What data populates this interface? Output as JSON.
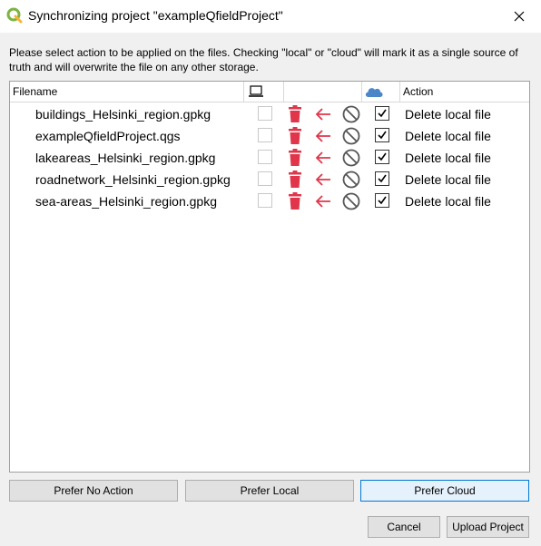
{
  "window": {
    "title": "Synchronizing project \"exampleQfieldProject\"",
    "app_icon": "qgis-q-icon",
    "close_icon": "close-x-icon"
  },
  "description": "Please select action to be applied on the files. Checking \"local\" or \"cloud\" will mark it as a single source of truth and will overwrite the file on any other storage.",
  "table": {
    "headers": {
      "filename": "Filename",
      "local_icon": "laptop-icon",
      "cloud_icon": "cloud-icon",
      "action": "Action"
    },
    "rows": [
      {
        "filename": "buildings_Helsinki_region.gpkg",
        "local_checked": false,
        "cloud_checked": true,
        "action": "Delete local file"
      },
      {
        "filename": "exampleQfieldProject.qgs",
        "local_checked": false,
        "cloud_checked": true,
        "action": "Delete local file"
      },
      {
        "filename": "lakeareas_Helsinki_region.gpkg",
        "local_checked": false,
        "cloud_checked": true,
        "action": "Delete local file"
      },
      {
        "filename": "roadnetwork_Helsinki_region.gpkg",
        "local_checked": false,
        "cloud_checked": true,
        "action": "Delete local file"
      },
      {
        "filename": "sea-areas_Helsinki_region.gpkg",
        "local_checked": false,
        "cloud_checked": true,
        "action": "Delete local file"
      }
    ],
    "row_icons": [
      "trash-icon",
      "arrow-left-icon",
      "no-action-icon"
    ]
  },
  "buttons": {
    "prefer_no_action": "Prefer No Action",
    "prefer_local": "Prefer Local",
    "prefer_cloud": "Prefer Cloud",
    "cancel": "Cancel",
    "upload_project": "Upload Project"
  },
  "colors": {
    "trash": "#e0354a",
    "arrow": "#e0354a",
    "cloud": "#4a86c8",
    "focus_border": "#0078d7"
  }
}
